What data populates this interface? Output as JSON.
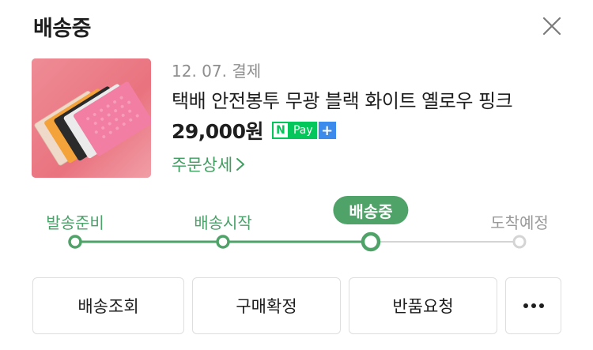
{
  "header": {
    "title": "배송중",
    "close_icon": "close-icon"
  },
  "order": {
    "date_text": "12. 07. 결제",
    "product_name": "택배 안전봉투 무광 블랙 화이트 옐로우 핑크",
    "price": "29,000원",
    "npay": {
      "n": "N",
      "pay": "Pay",
      "plus": "+",
      "green": "#03c75a",
      "blue": "#3a8bec"
    },
    "detail_link": "주문상세",
    "thumbnail_icon": "product-image"
  },
  "progress": {
    "steps": [
      {
        "label": "발송준비",
        "state": "done"
      },
      {
        "label": "배송시작",
        "state": "done"
      },
      {
        "label": "배송중",
        "state": "current"
      },
      {
        "label": "도착예정",
        "state": "future"
      }
    ],
    "active_color": "#4fa368",
    "inactive_color": "#d4d4d4"
  },
  "actions": {
    "track": "배송조회",
    "confirm": "구매확정",
    "return": "반품요청",
    "more_icon": "more-horizontal-icon"
  }
}
